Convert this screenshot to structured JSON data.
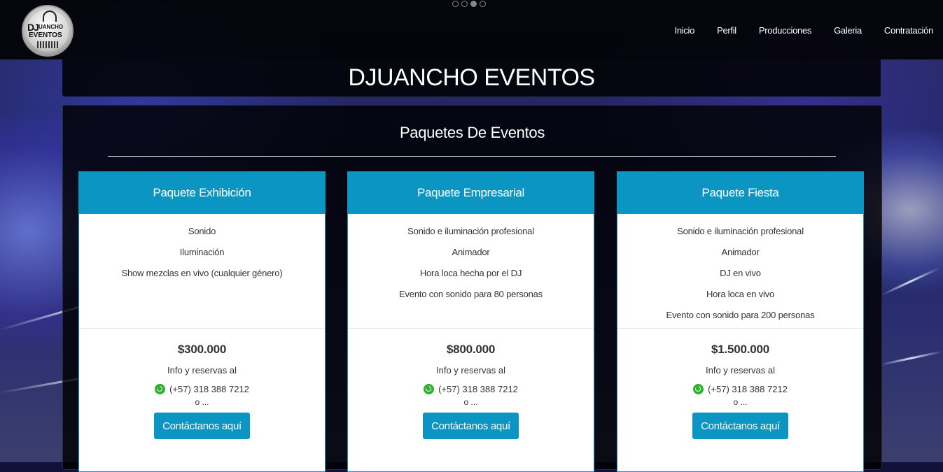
{
  "nav": {
    "logo": {
      "line1": "DJ",
      "line2": "UANCHO",
      "line3": "EVENTOS"
    },
    "carousel_dots": 4,
    "carousel_active": 3,
    "items": [
      "Inicio",
      "Perfil",
      "Producciones",
      "Galeria",
      "Contratación"
    ]
  },
  "site_title": "DJUANCHO EVENTOS",
  "section_title": "Paquetes De Eventos",
  "packages": [
    {
      "name": "Paquete Exhibición",
      "features": [
        "Sonido",
        "Iluminación",
        "Show mezclas en vivo (cualquier género)"
      ],
      "price": "$300.000",
      "info": "Info y reservas al",
      "phone": "(+57) 318 388 7212",
      "or": "o ...",
      "cta": "Contáctanos aquí"
    },
    {
      "name": "Paquete Empresarial",
      "features": [
        "Sonido e iluminación profesional",
        "Animador",
        "Hora loca hecha por el DJ",
        "Evento con sonido para 80 personas"
      ],
      "price": "$800.000",
      "info": "Info y reservas al",
      "phone": "(+57) 318 388 7212",
      "or": "o ...",
      "cta": "Contáctanos aquí"
    },
    {
      "name": "Paquete Fiesta",
      "features": [
        "Sonido e iluminación profesional",
        "Animador",
        "DJ en vivo",
        "Hora loca en vivo",
        "Evento con sonido para 200 personas"
      ],
      "price": "$1.500.000",
      "info": "Info y reservas al",
      "phone": "(+57) 318 388 7212",
      "or": "o ...",
      "cta": "Contáctanos aquí"
    }
  ],
  "colors": {
    "accent": "#0b95c3",
    "whatsapp": "#2fb12f",
    "overlay": "#000000"
  },
  "icons": {
    "phone": "whatsapp-icon"
  }
}
